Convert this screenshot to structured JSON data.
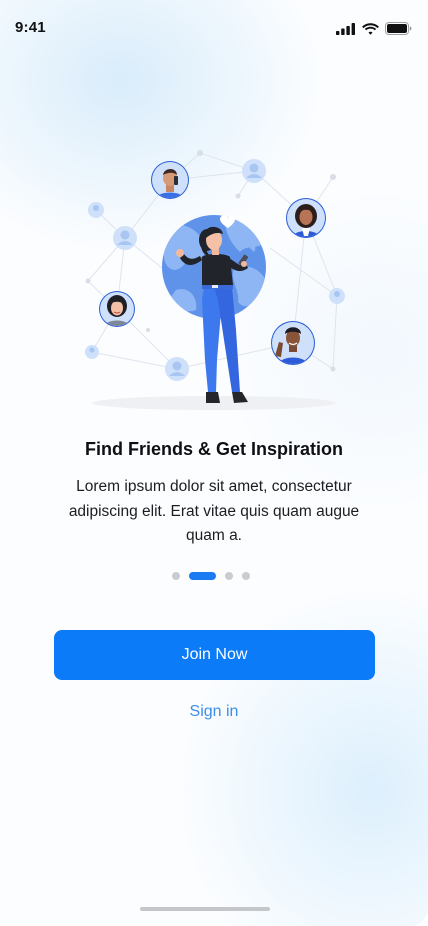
{
  "status_bar": {
    "time": "9:41",
    "icons": [
      "cellular-signal-icon",
      "wifi-icon",
      "battery-icon"
    ]
  },
  "onboarding": {
    "illustration": "people-network-globe-illustration",
    "title": "Find Friends & Get Inspiration",
    "description": "Lorem ipsum dolor sit amet, consectetur adipiscing elit. Erat vitae quis quam augue quam a.",
    "page_indicator": {
      "total": 4,
      "active_index": 1
    }
  },
  "actions": {
    "primary_label": "Join Now",
    "secondary_label": "Sign in"
  },
  "colors": {
    "accent": "#0b7bf7",
    "link": "#3c8ee6",
    "dot_inactive": "#c9ccd1",
    "text_primary": "#0f0f14"
  }
}
